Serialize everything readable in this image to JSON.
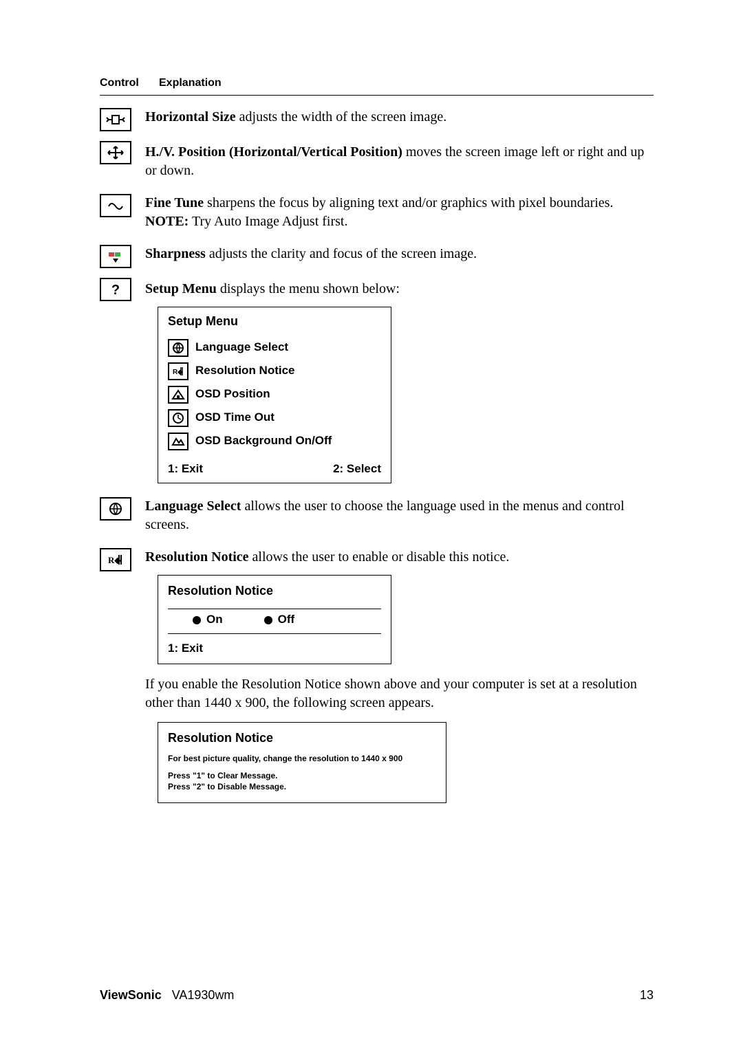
{
  "header": {
    "control": "Control",
    "explanation": "Explanation"
  },
  "items": {
    "hsize": {
      "title": "Horizontal Size",
      "desc": " adjusts the width of the screen image."
    },
    "hvpos": {
      "title": "H./V. Position (Horizontal/Vertical Position)",
      "desc": " moves the screen image left or right and up or down."
    },
    "finetune": {
      "title": "Fine Tune",
      "desc": " sharpens the focus by aligning text and/or graphics with pixel boundaries.",
      "note_label": "NOTE:",
      "note_text": " Try Auto Image Adjust first."
    },
    "sharpness": {
      "title": "Sharpness",
      "desc": " adjusts the clarity and focus of the screen image."
    },
    "setupmenu": {
      "title": "Setup Menu",
      "desc": " displays the menu shown below:"
    },
    "langsel": {
      "title": "Language Select",
      "desc": " allows the user to choose the language used in the menus and control screens."
    },
    "resnotice": {
      "title": "Resolution Notice",
      "desc": " allows the user to enable or disable this notice."
    },
    "resnotice_after": "If you enable the Resolution Notice shown above and your computer is set at a resolution other than 1440 x 900, the following screen appears."
  },
  "setup_menu": {
    "title": "Setup Menu",
    "opts": [
      "Language Select",
      "Resolution Notice",
      "OSD Position",
      "OSD Time Out",
      "OSD Background On/Off"
    ],
    "exit": "1: Exit",
    "select": "2: Select"
  },
  "res_notice_box": {
    "title": "Resolution Notice",
    "on": "On",
    "off": "Off",
    "exit": "1: Exit"
  },
  "res_notice_msg": {
    "title": "Resolution Notice",
    "body": "For best picture quality, change the resolution to 1440 x 900",
    "hint1": "Press \"1\" to Clear Message.",
    "hint2": "Press \"2\" to Disable Message."
  },
  "footer": {
    "brand": "ViewSonic",
    "model": "VA1930wm",
    "page": "13"
  }
}
